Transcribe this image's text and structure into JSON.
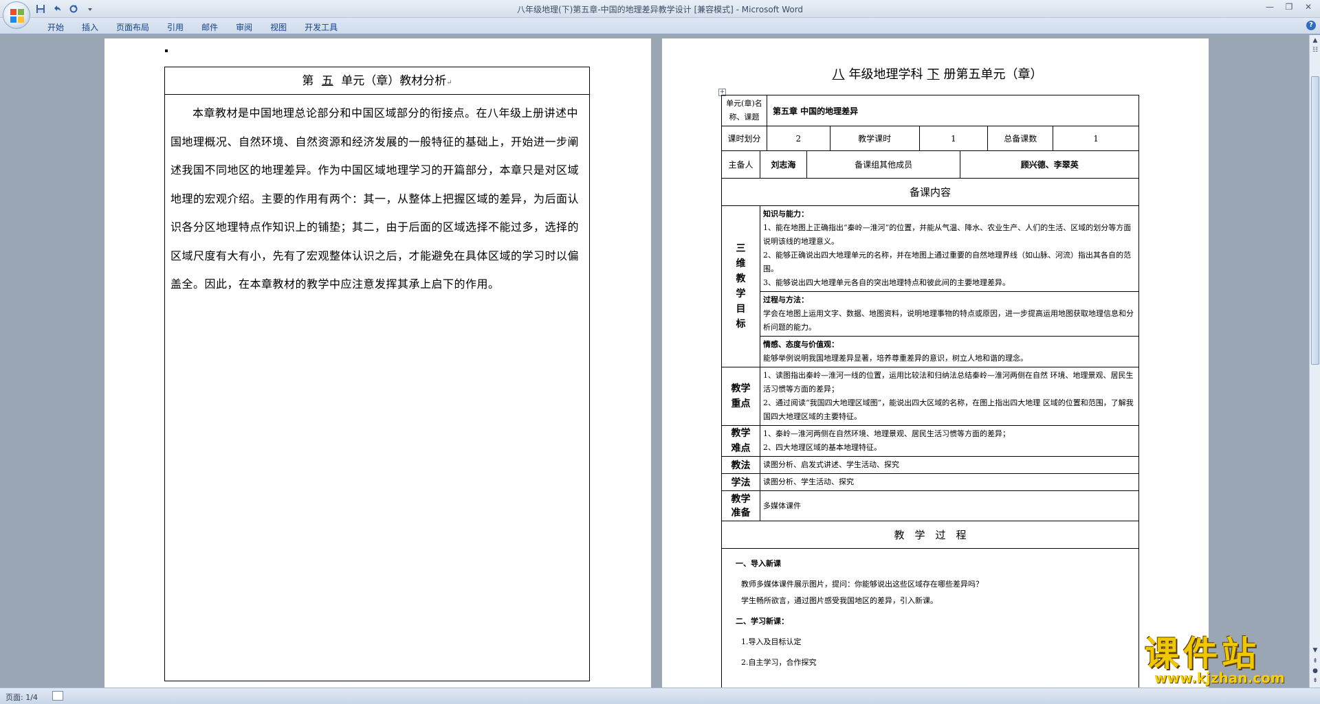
{
  "window": {
    "title": "八年级地理(下)第五章-中国的地理差异教学设计 [兼容模式] - Microsoft Word"
  },
  "qat": [
    "save-icon",
    "undo-icon",
    "redo-icon",
    "customize-icon"
  ],
  "ribbon": {
    "tabs": [
      "开始",
      "插入",
      "页面布局",
      "引用",
      "邮件",
      "审阅",
      "视图",
      "开发工具"
    ]
  },
  "left_page": {
    "title_prefix": "第",
    "title_unit": "五",
    "title_suffix": "单元（章）教材分析",
    "paragraph": "本章教材是中国地理总论部分和中国区域部分的衔接点。在八年级上册讲述中国地理概况、自然环境、自然资源和经济发展的一般特征的基础上，开始进一步阐述我国不同地区的地理差异。作为中国区域地理学习的开篇部分，本章只是对区域地理的宏观介绍。主要的作用有两个：其一，从整体上把握区域的差异，为后面认识各分区地理特点作知识上的铺垫；其二，由于后面的区域选择不能过多，选择的区域尺度有大有小，先有了宏观整体认识之后，才能避免在具体区域的学习时以偏盖全。因此，在本章教材的教学中应注意发挥其承上启下的作用。"
  },
  "right_page": {
    "title_grade": "八",
    "title_mid": "年级地理学科",
    "title_vol": "下",
    "title_suffix": "册第五单元（章）",
    "unit_label": "单元(章)名称、课题",
    "unit_value": "第五章 中国的地理差异",
    "hours_label": "课时划分",
    "hours_value": "2",
    "teach_hours_label": "教学课时",
    "teach_hours_value": "1",
    "total_label": "总备课数",
    "total_value": "1",
    "lead_label": "主备人",
    "lead_value": "刘志海",
    "members_label": "备课组其他成员",
    "members_value": "顾兴德、李翠英",
    "content_header": "备课内容",
    "goals_label": "三维教学目标",
    "knowledge_title": "知识与能力：",
    "knowledge_1": "1、能在地图上正确指出“秦岭—淮河”的位置，并能从气温、降水、农业生产、人们的生活、区域的划分等方面说明该线的地理意义。",
    "knowledge_2": "2、能够正确说出四大地理单元的名称，并在地图上通过重要的自然地理界线（如山脉、河流）指出其各自的范围。",
    "knowledge_3": "3、能够说出四大地理单元各自的突出地理特点和彼此间的主要地理差异。",
    "process_title": "过程与方法：",
    "process_text": "学会在地图上运用文字、数据、地图资料，说明地理事物的特点或原因，进一步提高运用地图获取地理信息和分析问题的能力。",
    "attitude_title": "情感、态度与价值观：",
    "attitude_text": "能够举例说明我国地理差异显著，培养尊重差异的意识，树立人地和谐的理念。",
    "key_label": "教学重点",
    "key_1": "1、读图指出秦岭—淮河一线的位置，运用比较法和归纳法总结秦岭—淮河两侧在自然 环境、地理景观、居民生活习惯等方面的差异；",
    "key_2": "2、通过阅读“我国四大地理区域图”，能说出四大区域的名称，在图上指出四大地理 区域的位置和范围，了解我国四大地理区域的主要特征。",
    "diff_label": "教学难点",
    "diff_1": "1、秦岭—淮河两侧在自然环境、地理景观、居民生活习惯等方面的差异；",
    "diff_2": "2、四大地理区域的基本地理特征。",
    "method_label": "教法",
    "method_value": "读图分析、启发式讲述、学生活动、探究",
    "learn_label": "学法",
    "learn_value": "读图分析、学生活动、探究",
    "prep_label": "教学准备",
    "prep_value": "多媒体课件",
    "process_header": "教　学　过　程",
    "intro_title": "一、导入新课",
    "intro_1": "教师多媒体课件展示图片，提问：你能够说出这些区域存在哪些差异吗？",
    "intro_2": "学生畅所欲言，通过图片感受我国地区的差异，引入新课。",
    "new_title": "二、学习新课：",
    "new_1": "1.导入及目标认定",
    "new_2": "2.自主学习，合作探究"
  },
  "status": {
    "page": "页面: 1/4"
  },
  "watermark": {
    "name": "课件站",
    "url": "www.kjzhan.com"
  }
}
